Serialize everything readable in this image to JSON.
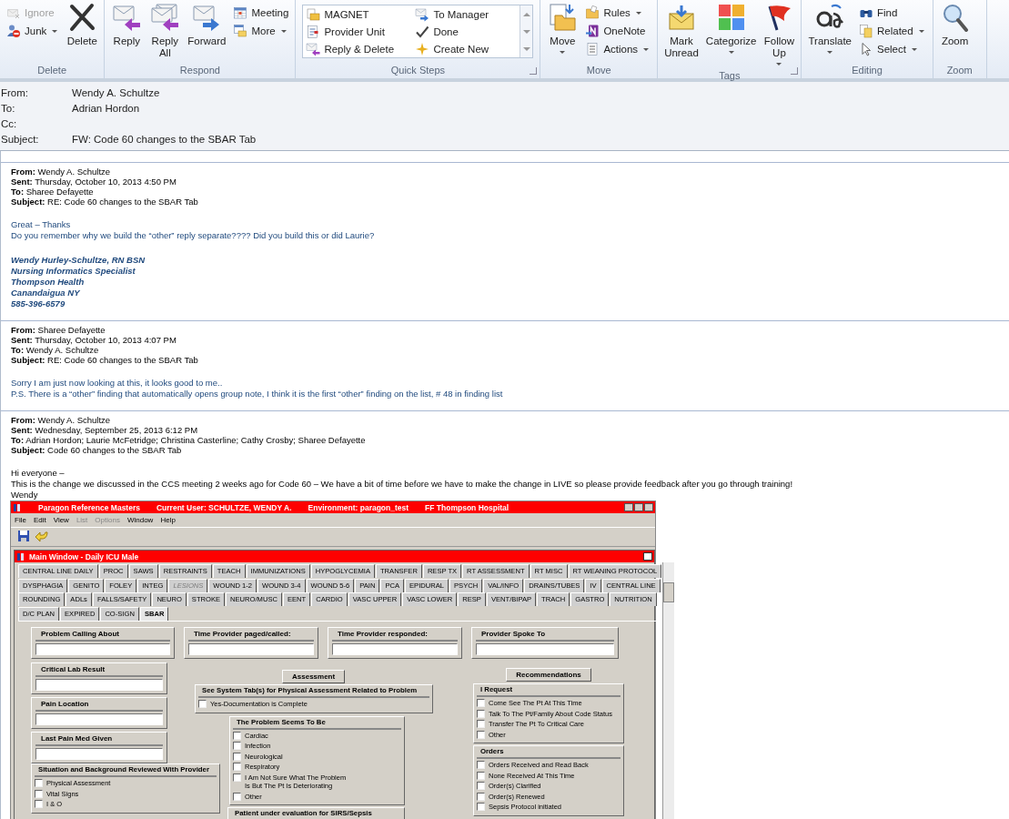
{
  "ribbon": {
    "groups": [
      {
        "label": "Delete",
        "launcher": false,
        "buttons": [
          {
            "label": "Ignore",
            "kind": "small",
            "disabled": true,
            "dropdown": false
          },
          {
            "label": "Junk",
            "kind": "small",
            "disabled": false,
            "dropdown": true
          },
          {
            "label": "Delete",
            "kind": "large",
            "disabled": false,
            "dropdown": false
          }
        ]
      },
      {
        "label": "Respond",
        "launcher": false,
        "buttons": [
          {
            "label": "Reply",
            "kind": "large",
            "disabled": false,
            "dropdown": false
          },
          {
            "label": "Reply All",
            "kind": "large",
            "disabled": false,
            "dropdown": false
          },
          {
            "label": "Forward",
            "kind": "large",
            "disabled": false,
            "dropdown": false
          },
          {
            "label": "Meeting",
            "kind": "small",
            "disabled": false,
            "dropdown": false
          },
          {
            "label": "More",
            "kind": "small",
            "disabled": false,
            "dropdown": true
          }
        ]
      },
      {
        "label": "Quick Steps",
        "launcher": true,
        "gallery": [
          "MAGNET",
          "To Manager",
          "Provider Unit",
          "Done",
          "Reply & Delete",
          "Create New"
        ]
      },
      {
        "label": "Move",
        "launcher": false,
        "buttons": [
          {
            "label": "Move",
            "kind": "large",
            "disabled": false,
            "dropdown": true
          },
          {
            "label": "Rules",
            "kind": "small",
            "disabled": false,
            "dropdown": true
          },
          {
            "label": "OneNote",
            "kind": "small",
            "disabled": false,
            "dropdown": false
          },
          {
            "label": "Actions",
            "kind": "small",
            "disabled": false,
            "dropdown": true
          }
        ]
      },
      {
        "label": "Tags",
        "launcher": true,
        "buttons": [
          {
            "label": "Mark Unread",
            "kind": "large",
            "disabled": false,
            "dropdown": false
          },
          {
            "label": "Categorize",
            "kind": "large",
            "disabled": false,
            "dropdown": true
          },
          {
            "label": "Follow Up",
            "kind": "large",
            "disabled": false,
            "dropdown": true
          }
        ]
      },
      {
        "label": "Editing",
        "launcher": false,
        "buttons": [
          {
            "label": "Translate",
            "kind": "large",
            "disabled": false,
            "dropdown": true
          },
          {
            "label": "Find",
            "kind": "small",
            "disabled": false,
            "dropdown": false
          },
          {
            "label": "Related",
            "kind": "small",
            "disabled": false,
            "dropdown": true
          },
          {
            "label": "Select",
            "kind": "small",
            "disabled": false,
            "dropdown": true
          }
        ]
      },
      {
        "label": "Zoom",
        "launcher": false,
        "buttons": [
          {
            "label": "Zoom",
            "kind": "large",
            "disabled": false,
            "dropdown": false
          }
        ]
      }
    ]
  },
  "header": {
    "fields": [
      {
        "label": "From:",
        "value": "Wendy A. Schultze"
      },
      {
        "label": "To:",
        "value": "Adrian Hordon"
      },
      {
        "label": "Cc:"
      },
      {
        "label": "Subject:",
        "value": "FW: Code 60 changes to the SBAR Tab"
      }
    ]
  },
  "messages": [
    {
      "kind": "reply",
      "headers": [
        "**From:** Wendy A. Schultze",
        "**Sent:** Thursday, October 10, 2013 4:50 PM",
        "**To:** Sharee Defayette",
        "**Subject:** RE: Code 60 changes to the SBAR Tab"
      ],
      "body": [
        "Great – Thanks",
        "Do you remember why we build the “other” reply separate???? Did you build this or did Laurie?"
      ],
      "signature": [
        "Wendy Hurley-Schultze, RN BSN",
        "Nursing Informatics Specialist",
        "Thompson Health",
        "Canandaigua NY",
        "585-396-6579"
      ]
    },
    {
      "kind": "reply",
      "headers": [
        "**From:** Sharee Defayette",
        "**Sent:** Thursday, October 10, 2013 4:07 PM",
        "**To:** Wendy A. Schultze",
        "**Subject:** RE: Code 60 changes to the SBAR Tab"
      ],
      "body": [
        "Sorry I am just now looking at this, it looks good to me..",
        "P.S.  There is a “other” finding that automatically opens group note, I think it is the first “other” finding on the list, # 48 in finding list"
      ]
    },
    {
      "kind": "original",
      "headers": [
        "**From:** Wendy A. Schultze",
        "**Sent:** Wednesday, September 25, 2013 6:12 PM",
        "**To:** Adrian Hordon; Laurie McFetridge; Christina Casterline; Cathy Crosby; Sharee Defayette",
        "**Subject:** Code 60 changes to the SBAR Tab"
      ],
      "body": [
        "Hi everyone –",
        "This is the change we discussed in the CCS meeting 2 weeks ago for Code 60 – We have a bit of time before we have to make the change in LIVE so please provide feedback after you go through training!",
        "Wendy"
      ]
    }
  ],
  "paragon": {
    "title_parts": [
      "Paragon Reference Masters",
      "Current User: SCHULTZE, WENDY A.",
      "Environment: paragon_test",
      "FF Thompson Hospital"
    ],
    "menu": [
      {
        "label": "File",
        "disabled": false
      },
      {
        "label": "Edit",
        "disabled": false
      },
      {
        "label": "View",
        "disabled": false
      },
      {
        "label": "List",
        "disabled": true
      },
      {
        "label": "Options",
        "disabled": true
      },
      {
        "label": "Window",
        "disabled": false
      },
      {
        "label": "Help",
        "disabled": false
      }
    ],
    "child_window": {
      "title": "Main Window - Daily ICU Male",
      "tab_rows": [
        [
          {
            "label": "CENTRAL LINE DAILY",
            "selected": false,
            "disabled": false
          },
          {
            "label": "PROC",
            "selected": false,
            "disabled": false
          },
          {
            "label": "SAWS",
            "selected": false,
            "disabled": false
          },
          {
            "label": "RESTRAINTS",
            "selected": false,
            "disabled": false
          },
          {
            "label": "TEACH",
            "selected": false,
            "disabled": false
          },
          {
            "label": "IMMUNIZATIONS",
            "selected": false,
            "disabled": false
          },
          {
            "label": "HYPOGLYCEMIA",
            "selected": false,
            "disabled": false
          },
          {
            "label": "TRANSFER",
            "selected": false,
            "disabled": false
          },
          {
            "label": "RESP TX",
            "selected": false,
            "disabled": false
          },
          {
            "label": "RT ASSESSMENT",
            "selected": false,
            "disabled": false
          },
          {
            "label": "RT MISC",
            "selected": false,
            "disabled": false
          },
          {
            "label": "RT WEANING PROTOCOL",
            "selected": false,
            "disabled": false
          }
        ],
        [
          {
            "label": "DYSPHAGIA",
            "selected": false,
            "disabled": false
          },
          {
            "label": "GENITO",
            "selected": false,
            "disabled": false
          },
          {
            "label": "FOLEY",
            "selected": false,
            "disabled": false
          },
          {
            "label": "INTEG",
            "selected": false,
            "disabled": false
          },
          {
            "label": "LESIONS",
            "selected": false,
            "disabled": true
          },
          {
            "label": "WOUND 1-2",
            "selected": false,
            "disabled": false
          },
          {
            "label": "WOUND 3-4",
            "selected": false,
            "disabled": false
          },
          {
            "label": "WOUND 5-6",
            "selected": false,
            "disabled": false
          },
          {
            "label": "PAIN",
            "selected": false,
            "disabled": false
          },
          {
            "label": "PCA",
            "selected": false,
            "disabled": false
          },
          {
            "label": "EPIDURAL",
            "selected": false,
            "disabled": false
          },
          {
            "label": "PSYCH",
            "selected": false,
            "disabled": false
          },
          {
            "label": "VAL/INFO",
            "selected": false,
            "disabled": false
          },
          {
            "label": "DRAINS/TUBES",
            "selected": false,
            "disabled": false
          },
          {
            "label": "IV",
            "selected": false,
            "disabled": false
          },
          {
            "label": "CENTRAL LINE",
            "selected": false,
            "disabled": false
          }
        ],
        [
          {
            "label": "ROUNDING",
            "selected": false,
            "disabled": false
          },
          {
            "label": "ADLs",
            "selected": false,
            "disabled": false
          },
          {
            "label": "FALLS/SAFETY",
            "selected": false,
            "disabled": false
          },
          {
            "label": "NEURO",
            "selected": false,
            "disabled": false
          },
          {
            "label": "STROKE",
            "selected": false,
            "disabled": false
          },
          {
            "label": "NEURO/MUSC",
            "selected": false,
            "disabled": false
          },
          {
            "label": "EENT",
            "selected": false,
            "disabled": false
          },
          {
            "label": "CARDIO",
            "selected": false,
            "disabled": false
          },
          {
            "label": "VASC UPPER",
            "selected": false,
            "disabled": false
          },
          {
            "label": "VASC LOWER",
            "selected": false,
            "disabled": false
          },
          {
            "label": "RESP",
            "selected": false,
            "disabled": false
          },
          {
            "label": "VENT/BIPAP",
            "selected": false,
            "disabled": false
          },
          {
            "label": "TRACH",
            "selected": false,
            "disabled": false
          },
          {
            "label": "GASTRO",
            "selected": false,
            "disabled": false
          },
          {
            "label": "NUTRITION",
            "selected": false,
            "disabled": false
          }
        ],
        [
          {
            "label": "D/C PLAN",
            "selected": false,
            "disabled": false
          },
          {
            "label": "EXPIRED",
            "selected": false,
            "disabled": false
          },
          {
            "label": "CO-SIGN",
            "selected": false,
            "disabled": false
          },
          {
            "label": "SBAR",
            "selected": true,
            "disabled": false
          }
        ]
      ],
      "form": {
        "top_fields": [
          {
            "label": "Problem Calling About"
          },
          {
            "label": "Time Provider paged/called:"
          },
          {
            "label": "Time Provider responded:"
          },
          {
            "label": "Provider Spoke To"
          }
        ],
        "left_fields": [
          {
            "label": "Critical Lab Result"
          },
          {
            "label": "Pain Location"
          },
          {
            "label": "Last Pain Med Given"
          }
        ],
        "situation": {
          "title": "Situation and Background Reviewed With Provider",
          "items": [
            {
              "label": "Physical Assessment",
              "checked": false
            },
            {
              "label": "Vital Signs",
              "checked": false
            },
            {
              "label": "I & O",
              "checked": false
            }
          ]
        },
        "assessment": {
          "button": "Assessment",
          "system_group": {
            "title": "See System Tab(s) for Physical Assessment Related to Problem",
            "items": [
              {
                "label": "Yes-Documentation is Complete",
                "checked": false
              }
            ]
          },
          "problem_group": {
            "title": "The Problem Seems To Be",
            "items": [
              {
                "label": "Cardiac",
                "checked": false
              },
              {
                "label": "Infection",
                "checked": false
              },
              {
                "label": "Neurological",
                "checked": false
              },
              {
                "label": "Respiratory",
                "checked": false
              },
              {
                "label": "I Am Not Sure What The Problem\nIs But The Pt Is Deteriorating",
                "checked": false
              },
              {
                "label": "Other",
                "checked": false
              }
            ]
          },
          "sepsis_group": {
            "title": "Patient under evaluation for SIRS/Sepsis"
          }
        },
        "recommendations": {
          "button": "Recommendations",
          "groups": [
            {
              "title": "I Request",
              "items": [
                {
                  "label": "Come See The Pt At This Time",
                  "checked": false
                },
                {
                  "label": "Talk To The Pt/Family About Code Status",
                  "checked": false
                },
                {
                  "label": "Transfer The Pt To Critical Care",
                  "checked": false
                },
                {
                  "label": "Other",
                  "checked": false
                }
              ]
            },
            {
              "title": "Orders",
              "items": [
                {
                  "label": "Orders Received and Read Back",
                  "checked": false
                },
                {
                  "label": "None Received At This Time",
                  "checked": false
                },
                {
                  "label": "Order(s) Clarified",
                  "checked": false
                },
                {
                  "label": "Order(s) Renewed",
                  "checked": false
                },
                {
                  "label": "Sepsis Protocol initiated",
                  "checked": false
                }
              ]
            }
          ]
        }
      }
    }
  }
}
